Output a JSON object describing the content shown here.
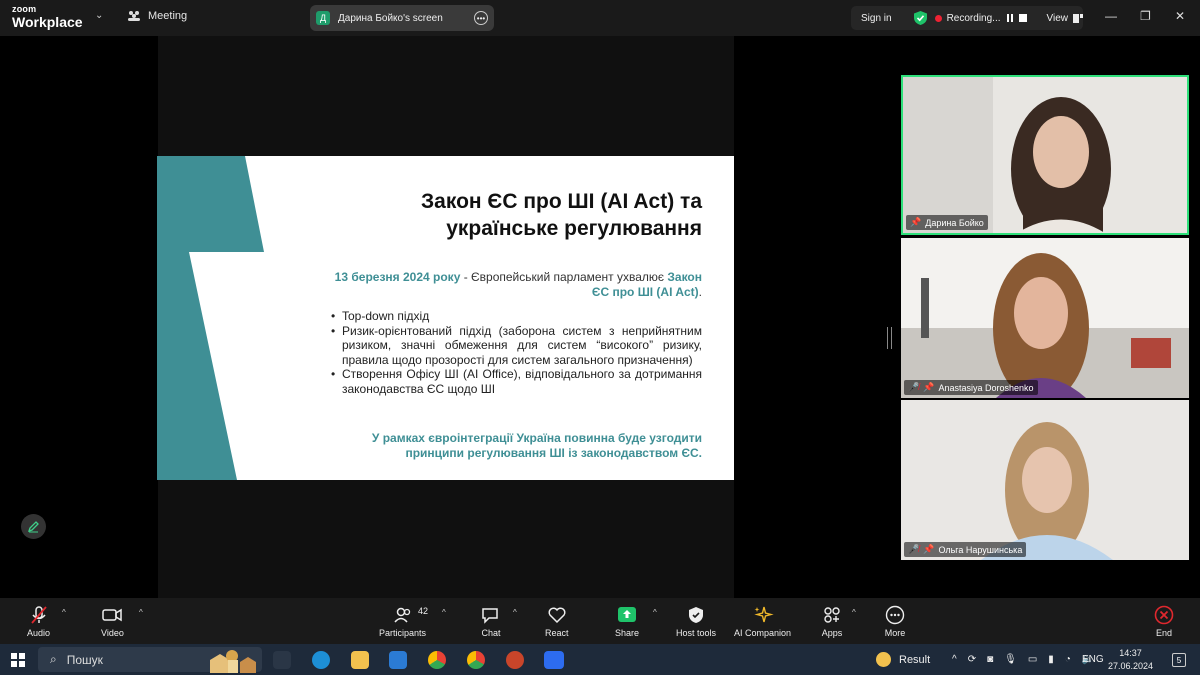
{
  "app": {
    "logo_line1": "zoom",
    "logo_line2": "Workplace",
    "meeting_label": "Meeting"
  },
  "screen_share": {
    "avatar_letter": "Д",
    "label": "Дарина Бойко's screen"
  },
  "top_right": {
    "signin": "Sign in",
    "recording": "Recording...",
    "view": "View"
  },
  "slide": {
    "title": "Закон ЄС про ШІ (AI Act) та українське регулювання",
    "date_highlight": "13 березня 2024 року",
    "date_rest": " - Європейський парламент ухвалює ",
    "act_highlight": "Закон ЄС про ШІ (AI Act)",
    "act_end": ".",
    "bullets": [
      "Top-down підхід",
      "Ризик-орієнтований підхід (заборона систем з неприйнятним ризиком, значні обмеження для систем “високого” ризику, правила щодо прозорості для систем загального призначення)",
      "Створення Офісу ШІ (AI Office), відповідального за дотримання законодавства ЄС щодо ШІ"
    ],
    "footer": "У рамках євроінтеграції Україна повинна буде узгодити принципи регулювання ШІ із законодавством ЄС."
  },
  "participants": [
    {
      "name": "Дарина Бойко",
      "muted": false,
      "active": true
    },
    {
      "name": "Anastasiya Doroshenko",
      "muted": true,
      "active": false
    },
    {
      "name": "Ольга Нарушинська",
      "muted": true,
      "active": false
    }
  ],
  "toolbar": {
    "audio": "Audio",
    "video": "Video",
    "participants": "Participants",
    "participants_count": "42",
    "chat": "Chat",
    "react": "React",
    "share": "Share",
    "host_tools": "Host tools",
    "ai_companion": "AI Companion",
    "apps": "Apps",
    "more": "More",
    "end": "End"
  },
  "taskbar": {
    "search_placeholder": "Пошук",
    "weather": "Result",
    "lang": "ENG",
    "time": "14:37",
    "date": "27.06.2024",
    "notifications": "5"
  },
  "colors": {
    "accent_teal": "#3f8f95",
    "active_border": "#2ee07a",
    "share_green": "#1fc36a",
    "end_red": "#e0282e"
  }
}
